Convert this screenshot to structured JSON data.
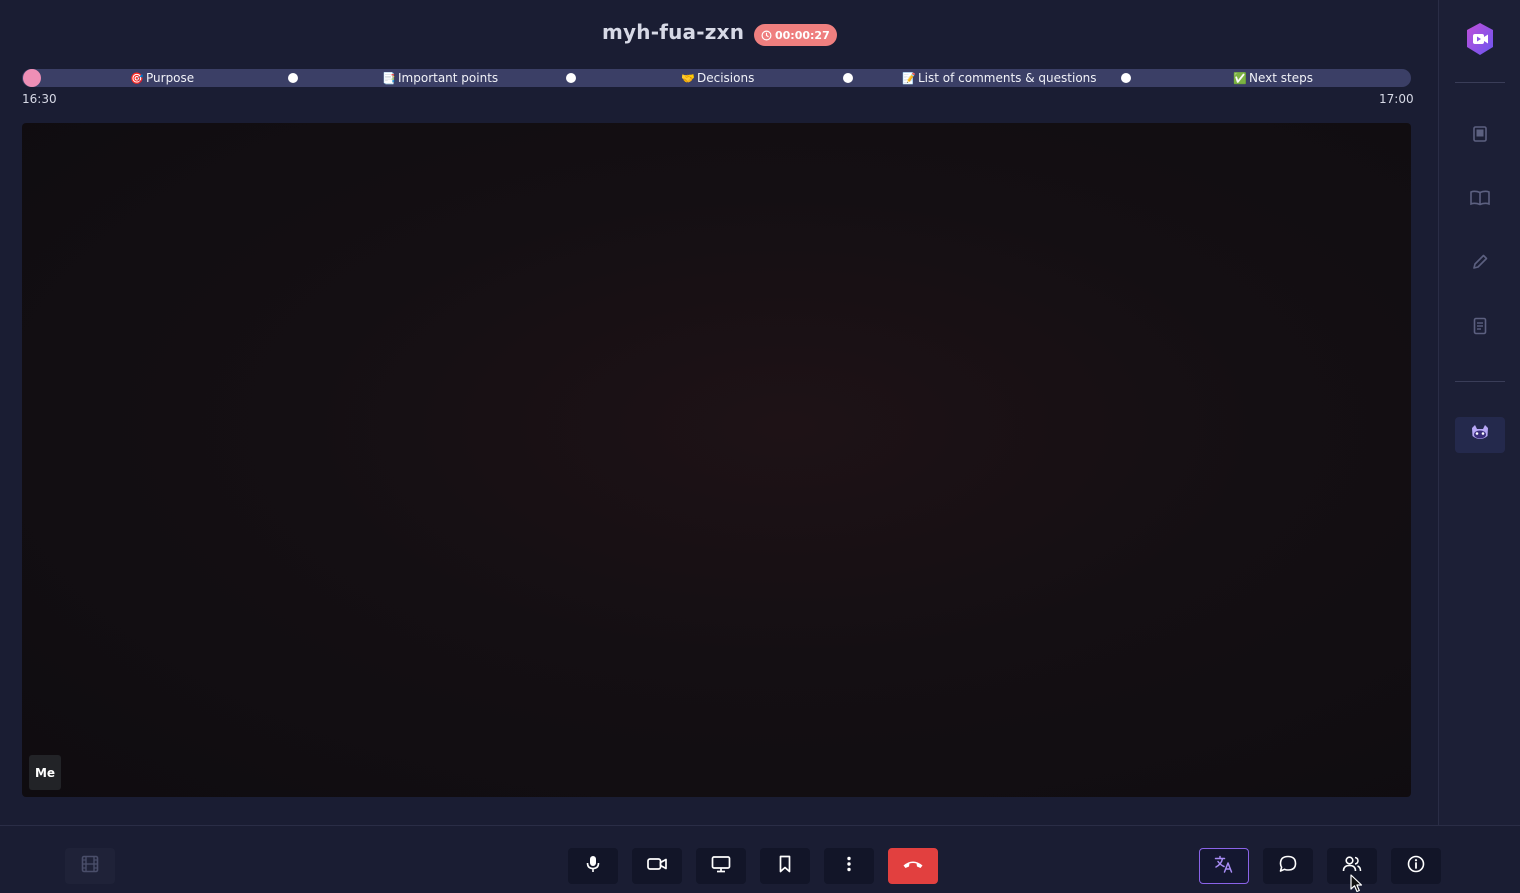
{
  "meeting": {
    "title": "myh-fua-zxn",
    "elapsed": "00:00:27"
  },
  "agenda": {
    "start_time": "16:30",
    "end_time": "17:00",
    "items": [
      {
        "emoji": "🎯",
        "label": "Purpose"
      },
      {
        "emoji": "📑",
        "label": "Important points"
      },
      {
        "emoji": "🤝",
        "label": "Decisions"
      },
      {
        "emoji": "📝",
        "label": "List of comments & questions"
      },
      {
        "emoji": "✅",
        "label": "Next steps"
      }
    ]
  },
  "video": {
    "self_label": "Me"
  },
  "sidebar": {
    "buttons": [
      {
        "icon": "notebook-icon"
      },
      {
        "icon": "book-open-icon"
      },
      {
        "icon": "pencil-icon"
      },
      {
        "icon": "document-icon"
      },
      {
        "icon": "assistant-mascot-icon"
      }
    ]
  },
  "toolbar": {
    "left": [
      {
        "icon": "film-icon"
      }
    ],
    "center": [
      {
        "icon": "microphone-icon"
      },
      {
        "icon": "camera-icon"
      },
      {
        "icon": "screen-share-icon"
      },
      {
        "icon": "bookmark-icon"
      },
      {
        "icon": "more-vertical-icon"
      },
      {
        "icon": "hang-up-icon"
      }
    ],
    "right": [
      {
        "icon": "translate-icon"
      },
      {
        "icon": "chat-icon"
      },
      {
        "icon": "participants-icon"
      },
      {
        "icon": "info-icon"
      }
    ]
  },
  "colors": {
    "background": "#1a1d33",
    "timer_badge": "#ef7f7f",
    "timeline_track": "#3b3f66",
    "timeline_progress": "#ee8fb6",
    "hangup": "#e2403f",
    "accent": "#8a63e8"
  }
}
